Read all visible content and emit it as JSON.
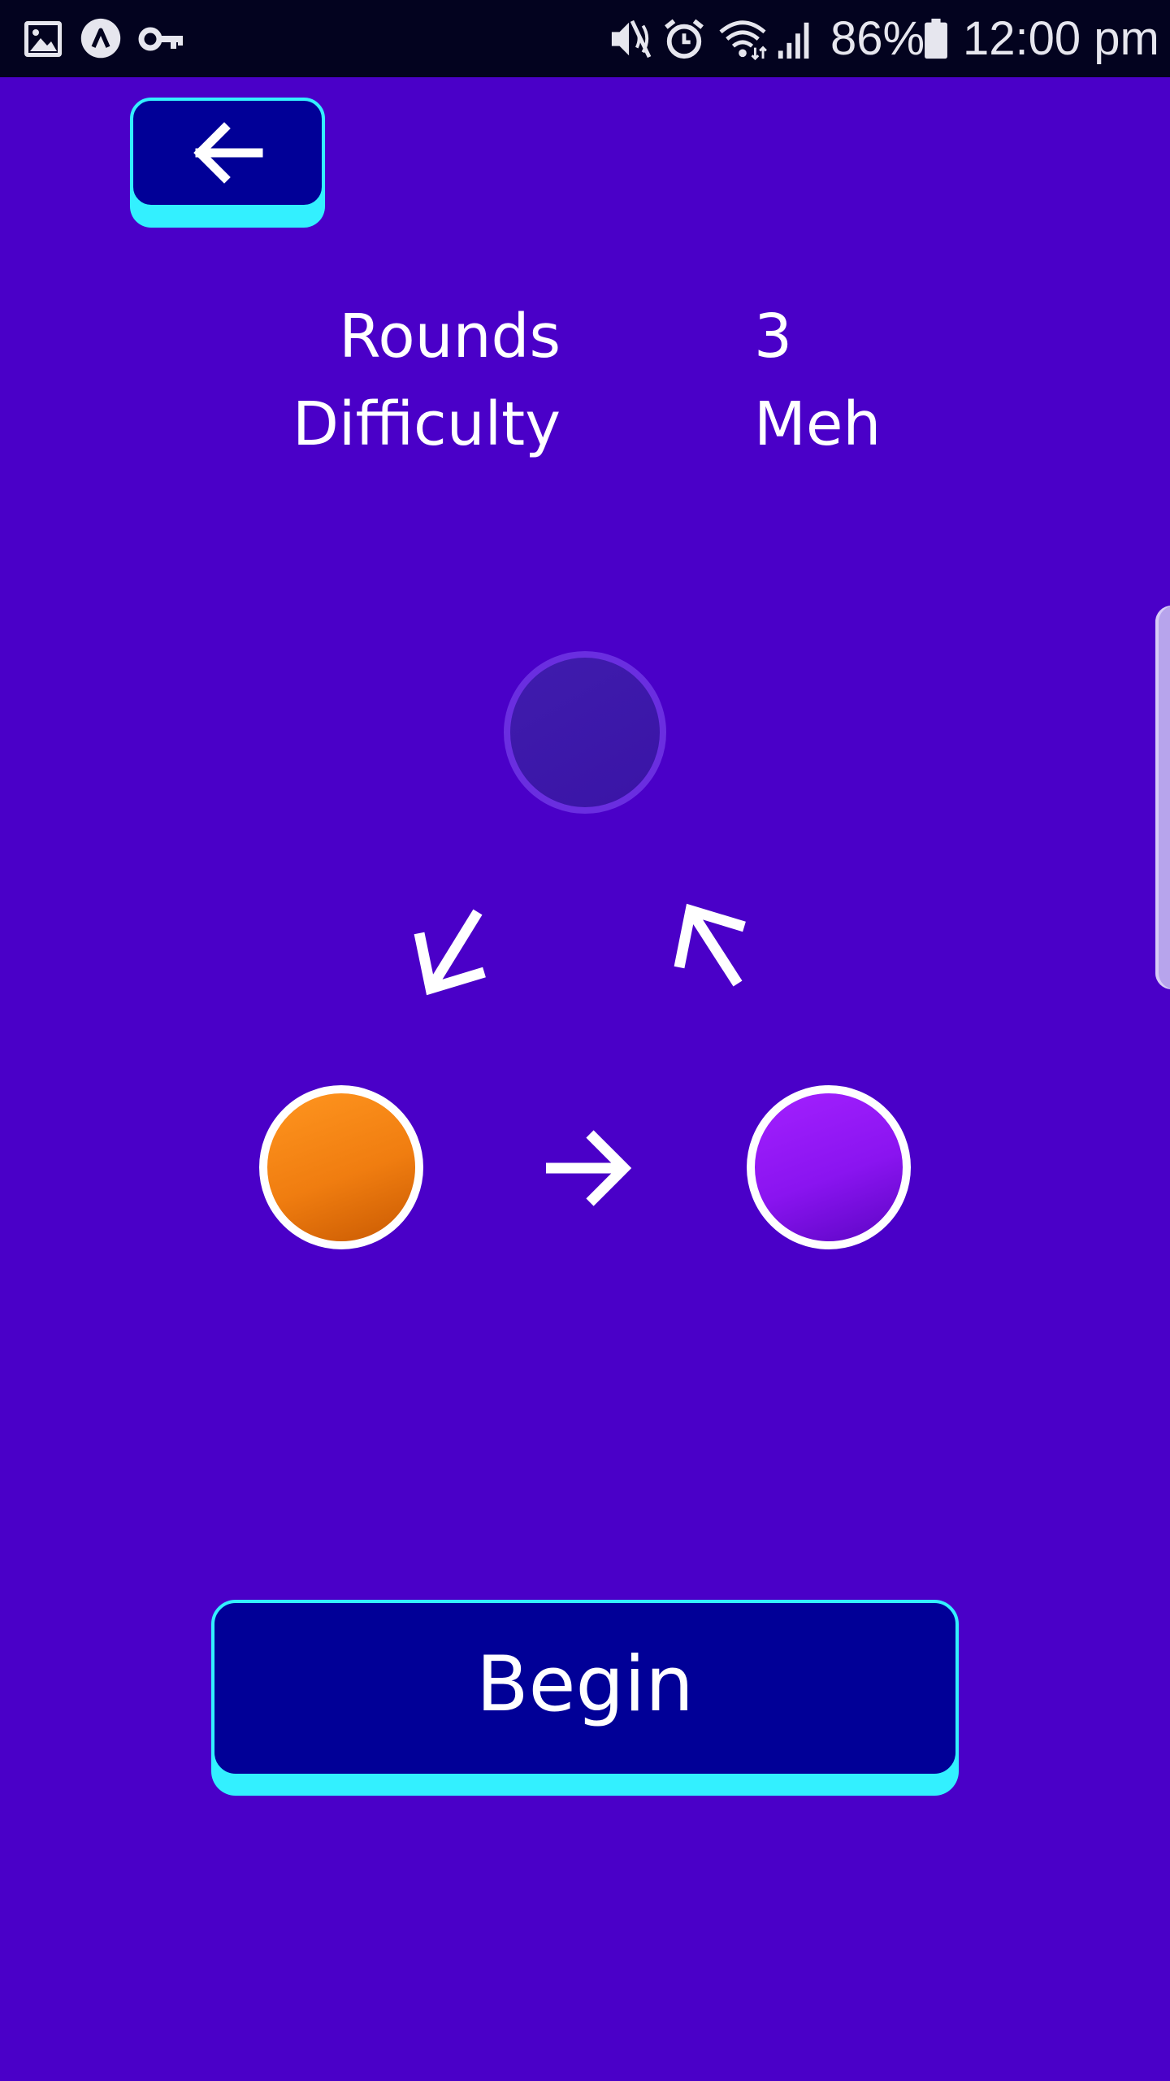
{
  "status_bar": {
    "left_icons": [
      "gallery-icon",
      "app-logo-icon",
      "vpn-key-icon"
    ],
    "right_icons": [
      "mute-icon",
      "alarm-icon",
      "wifi-icon",
      "signal-icon",
      "battery-icon"
    ],
    "battery_percent": "86%",
    "time": "12:00 pm"
  },
  "header": {
    "back_icon": "arrow-left-icon"
  },
  "settings": {
    "rounds_label": "Rounds",
    "rounds_value": "3",
    "difficulty_label": "Difficulty",
    "difficulty_value": "Meh"
  },
  "diagram": {
    "top_circle_color": "#3d18aa",
    "left_circle_color": "#f5861a",
    "right_circle_color": "#9618f8",
    "arrows": [
      "arrow-down-left-icon",
      "arrow-up-left-icon",
      "arrow-right-icon"
    ]
  },
  "actions": {
    "begin_label": "Begin"
  },
  "colors": {
    "background": "#4a00c8",
    "button_face": "#010097",
    "button_accent": "#33f0ff",
    "status_bar": "#03031f"
  }
}
